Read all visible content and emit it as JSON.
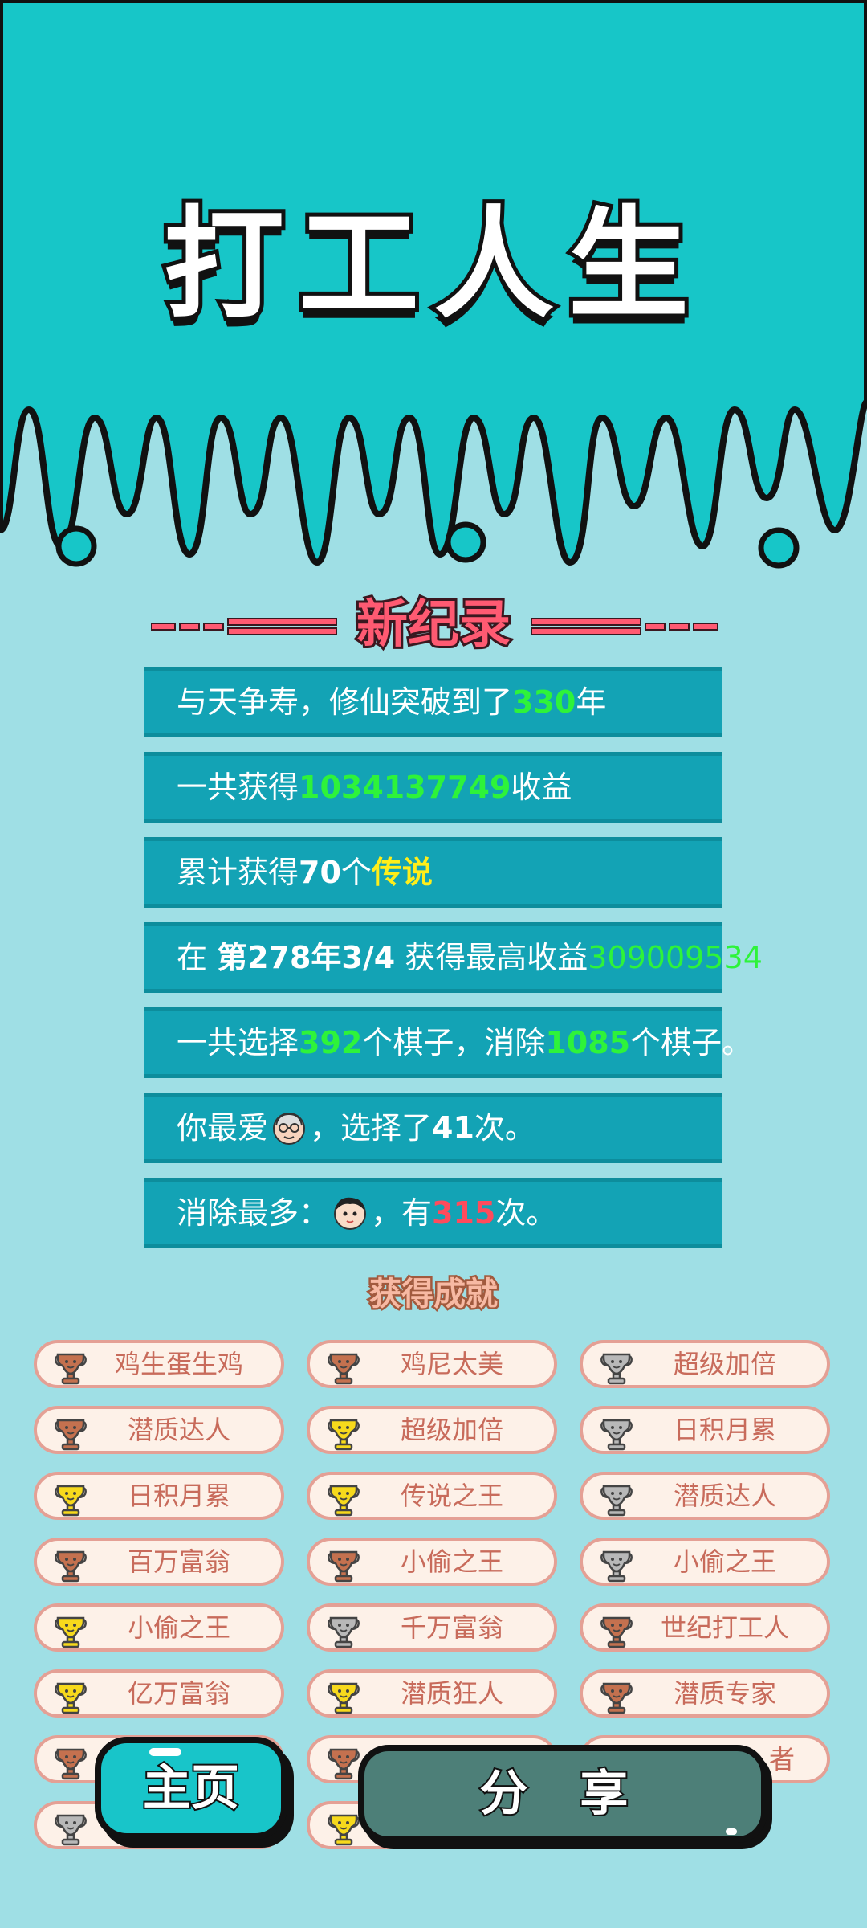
{
  "title": "打工人生",
  "record": {
    "title": "新纪录"
  },
  "stats": [
    {
      "id": "cultivation",
      "parts": [
        {
          "text": "与天争寿，修仙突破到了",
          "cls": ""
        },
        {
          "text": "330",
          "cls": "g"
        },
        {
          "text": "年",
          "cls": ""
        }
      ]
    },
    {
      "id": "total-income",
      "parts": [
        {
          "text": "一共获得",
          "cls": ""
        },
        {
          "text": "1034137749",
          "cls": "g"
        },
        {
          "text": "收益",
          "cls": ""
        }
      ]
    },
    {
      "id": "legends",
      "parts": [
        {
          "text": "累计获得",
          "cls": ""
        },
        {
          "text": "70",
          "cls": "b"
        },
        {
          "text": "个",
          "cls": ""
        },
        {
          "text": "传说",
          "cls": "y"
        }
      ]
    },
    {
      "id": "best-income",
      "parts": [
        {
          "text": "在 ",
          "cls": ""
        },
        {
          "text": "第278年3/4",
          "cls": "b"
        },
        {
          "text": " 获得最高收益",
          "cls": ""
        },
        {
          "text": "309009534",
          "cls": "g2"
        }
      ]
    },
    {
      "id": "pieces",
      "parts": [
        {
          "text": "一共选择",
          "cls": ""
        },
        {
          "text": "392",
          "cls": "g"
        },
        {
          "text": "个棋子，消除",
          "cls": ""
        },
        {
          "text": "1085",
          "cls": "g"
        },
        {
          "text": "个棋子。",
          "cls": ""
        }
      ]
    },
    {
      "id": "favorite",
      "parts": [
        {
          "text": "你最爱",
          "cls": ""
        },
        {
          "icon": "old-man-face-icon"
        },
        {
          "text": "，选择了",
          "cls": ""
        },
        {
          "text": "41",
          "cls": "b"
        },
        {
          "text": "次。",
          "cls": ""
        }
      ]
    },
    {
      "id": "most-cleared",
      "parts": [
        {
          "text": "消除最多：",
          "cls": ""
        },
        {
          "icon": "boy-face-icon"
        },
        {
          "text": "，有",
          "cls": ""
        },
        {
          "text": "315",
          "cls": "r"
        },
        {
          "text": "次。",
          "cls": ""
        }
      ]
    }
  ],
  "achievements": {
    "title": "获得成就",
    "items": [
      {
        "label": "鸡生蛋生鸡",
        "cup": "bronze"
      },
      {
        "label": "鸡尼太美",
        "cup": "bronze"
      },
      {
        "label": "超级加倍",
        "cup": "silver"
      },
      {
        "label": "潜质达人",
        "cup": "bronze"
      },
      {
        "label": "超级加倍",
        "cup": "gold"
      },
      {
        "label": "日积月累",
        "cup": "silver"
      },
      {
        "label": "日积月累",
        "cup": "gold"
      },
      {
        "label": "传说之王",
        "cup": "gold"
      },
      {
        "label": "潜质达人",
        "cup": "silver"
      },
      {
        "label": "百万富翁",
        "cup": "bronze"
      },
      {
        "label": "小偷之王",
        "cup": "bronze"
      },
      {
        "label": "小偷之王",
        "cup": "silver"
      },
      {
        "label": "小偷之王",
        "cup": "gold"
      },
      {
        "label": "千万富翁",
        "cup": "silver"
      },
      {
        "label": "世纪打工人",
        "cup": "bronze"
      },
      {
        "label": "亿万富翁",
        "cup": "gold"
      },
      {
        "label": "潜质狂人",
        "cup": "gold"
      },
      {
        "label": "潜质专家",
        "cup": "bronze"
      },
      {
        "label": "",
        "cup": "bronze"
      },
      {
        "label": "",
        "cup": "bronze"
      },
      {
        "label": "者",
        "cup": ""
      },
      {
        "label": "",
        "cup": "silver"
      },
      {
        "label": "",
        "cup": "gold"
      }
    ]
  },
  "buttons": {
    "home": "主页",
    "share": "分 享"
  },
  "colors": {
    "top_bg": "#17c6c8",
    "page_bg": "#9fdfe5",
    "stat_bg": "#13a3b5",
    "highlight_green": "#2ef33a",
    "bronze": "#c4714f",
    "silver": "#b8b8b8",
    "gold": "#f7d91c"
  }
}
